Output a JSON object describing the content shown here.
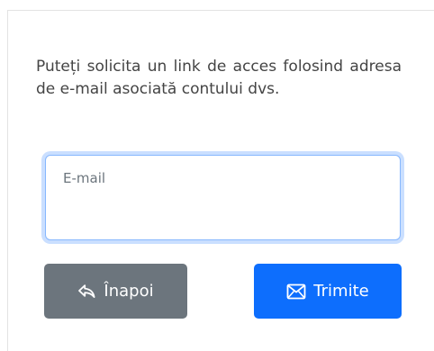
{
  "form": {
    "description": "Puteți solicita un link de acces folosind adresa de e-mail asociată contului dvs.",
    "email_placeholder": "E-mail",
    "email_value": ""
  },
  "buttons": {
    "back_label": "Înapoi",
    "back_icon": "reply-icon",
    "send_label": "Trimite",
    "send_icon": "envelope-icon"
  },
  "colors": {
    "back_button": "#6c757d",
    "send_button": "#0d6efd",
    "input_focus_border": "#86b7fe"
  }
}
